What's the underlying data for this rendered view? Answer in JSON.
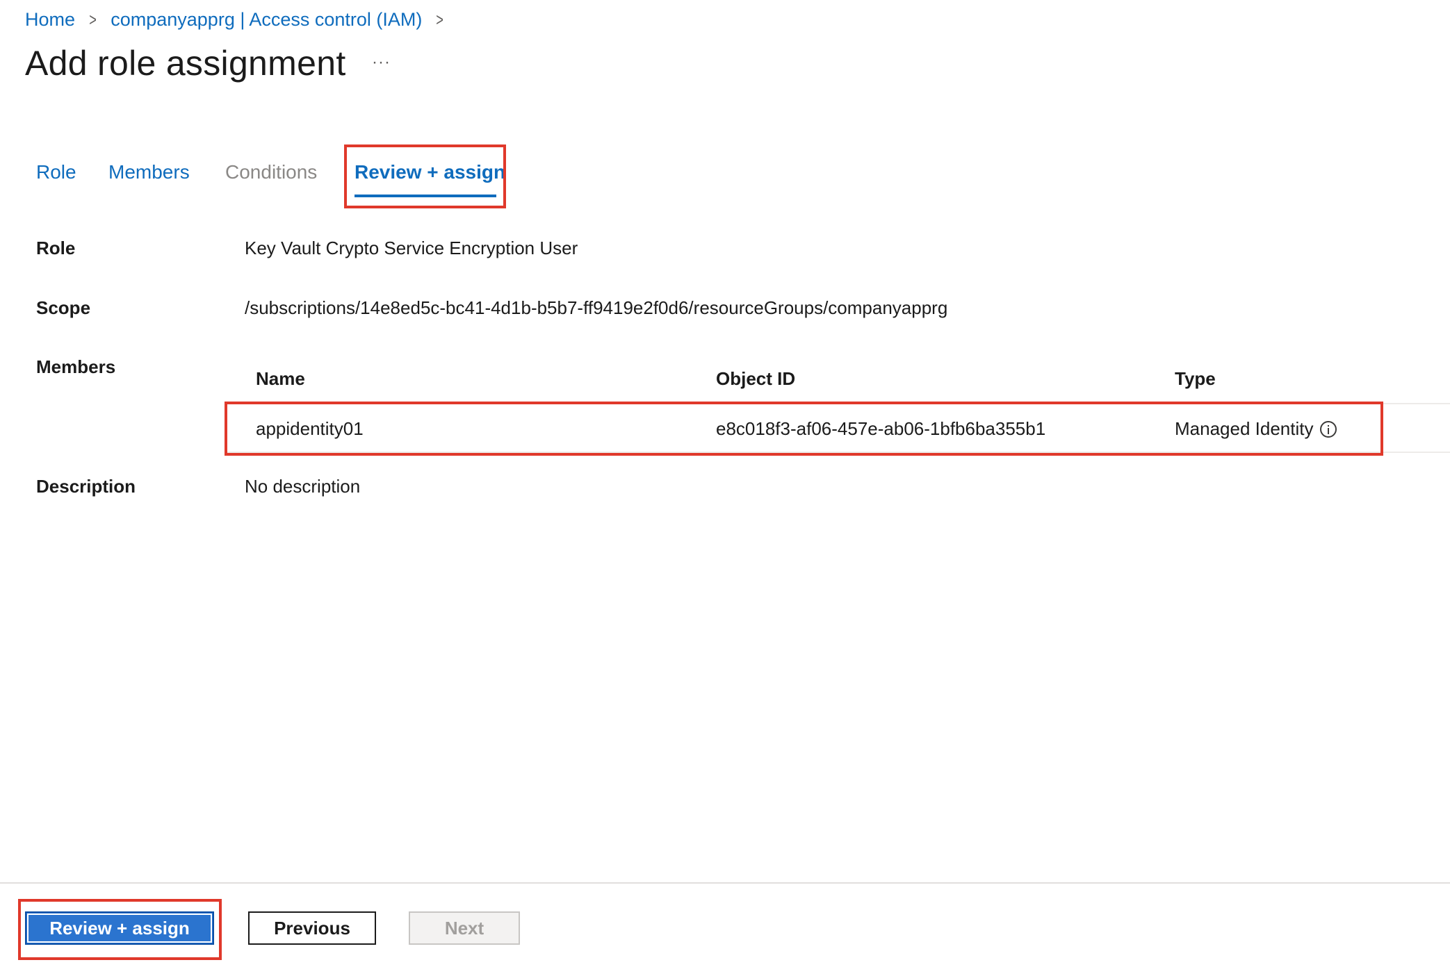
{
  "breadcrumb": {
    "items": [
      {
        "label": "Home"
      },
      {
        "label": "companyapprg | Access control (IAM)"
      }
    ],
    "separator": ">"
  },
  "page": {
    "title": "Add role assignment",
    "more_label": "···"
  },
  "tabs": [
    {
      "label": "Role",
      "state": "link"
    },
    {
      "label": "Members",
      "state": "link"
    },
    {
      "label": "Conditions",
      "state": "disabled"
    },
    {
      "label": "Review + assign",
      "state": "selected"
    }
  ],
  "details": {
    "role_label": "Role",
    "role_value": "Key Vault Crypto Service Encryption User",
    "scope_label": "Scope",
    "scope_value": "/subscriptions/14e8ed5c-bc41-4d1b-b5b7-ff9419e2f0d6/resourceGroups/companyapprg",
    "members_label": "Members",
    "description_label": "Description",
    "description_value": "No description"
  },
  "members_table": {
    "columns": [
      "Name",
      "Object ID",
      "Type"
    ],
    "rows": [
      {
        "name": "appidentity01",
        "object_id": "e8c018f3-af06-457e-ab06-1bfb6ba355b1",
        "type": "Managed Identity"
      }
    ]
  },
  "footer": {
    "primary_label": "Review + assign",
    "previous_label": "Previous",
    "next_label": "Next",
    "next_disabled": true
  },
  "colors": {
    "accent": "#0f6cbd",
    "primary_button": "#2b74cf",
    "highlight": "#e0392b"
  }
}
